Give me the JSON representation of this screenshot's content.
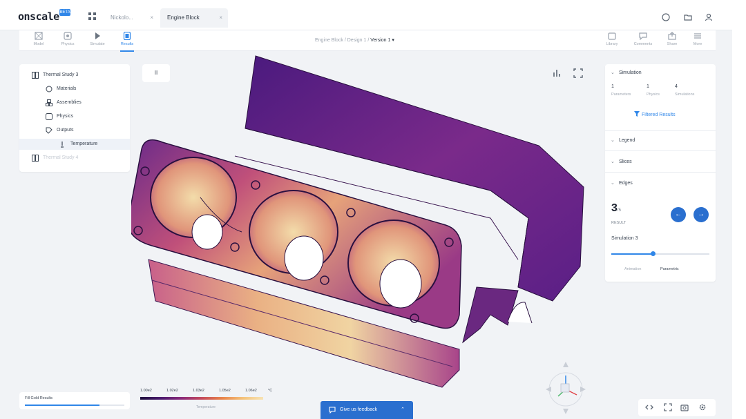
{
  "app": {
    "logo": "onscale",
    "logo_badge": "BETA"
  },
  "tabs": [
    {
      "label": "Nickolo...",
      "close": "×"
    },
    {
      "label": "Engine Block",
      "close": "×"
    }
  ],
  "toolbar": {
    "tools": [
      {
        "label": "Model",
        "icon": "model-icon"
      },
      {
        "label": "Physics",
        "icon": "physics-icon"
      },
      {
        "label": "Simulate",
        "icon": "simulate-icon"
      },
      {
        "label": "Results",
        "icon": "results-icon",
        "active": true
      }
    ],
    "right_tools": [
      {
        "label": "Library",
        "icon": "library-icon"
      },
      {
        "label": "Comments",
        "icon": "comments-icon"
      },
      {
        "label": "Share",
        "icon": "share-icon"
      },
      {
        "label": "More",
        "icon": "more-icon"
      }
    ]
  },
  "breadcrumb": {
    "part1": "Engine Block",
    "sep": "/",
    "part2": "Design 1",
    "current": "Version 1"
  },
  "tree": {
    "items": [
      {
        "label": "Thermal Study 3",
        "icon": "study-icon"
      },
      {
        "label": "Materials",
        "icon": "materials-icon"
      },
      {
        "label": "Assemblies",
        "icon": "assemblies-icon"
      },
      {
        "label": "Physics",
        "icon": "physics-icon"
      },
      {
        "label": "Outputs",
        "icon": "outputs-icon"
      },
      {
        "label": "Temperature",
        "icon": "temperature-icon"
      },
      {
        "label": "Thermal Study 4",
        "icon": "study-icon"
      }
    ]
  },
  "viewport": {
    "btn_label": "II"
  },
  "simulation": {
    "title": "Simulation",
    "stats": [
      {
        "value": "1",
        "label": "Parameters"
      },
      {
        "value": "1",
        "label": "Physics"
      },
      {
        "value": "4",
        "label": "Simulations"
      }
    ],
    "link": "Filtered Results",
    "sections": [
      "Legend",
      "Slices",
      "Edges"
    ],
    "edges_value": "3",
    "edges_unit": "/5",
    "edges_label": "RESULT",
    "sim_label": "Simulation 3",
    "slider_fraction": 0.42,
    "footer_left": "Animation",
    "footer_right": "Parametric"
  },
  "bottom_left": {
    "label": "Fill Gold Results",
    "progress": 0.75
  },
  "legend": {
    "ticks": [
      "1.00e2",
      "1.02e2",
      "1.03e2",
      "1.05e2",
      "1.06e2",
      "°C"
    ],
    "caption": "Temperature",
    "gradient": [
      "#1e0e3c",
      "#4a1a6e",
      "#8a2a7a",
      "#c44a5c",
      "#e8844a",
      "#f4c27a",
      "#f7e3b4"
    ]
  },
  "feedback": {
    "label": "Give us feedback",
    "chevron": "⌃"
  },
  "colors": {
    "accent": "#2f86e8",
    "accent_dark": "#2a6fcf"
  }
}
